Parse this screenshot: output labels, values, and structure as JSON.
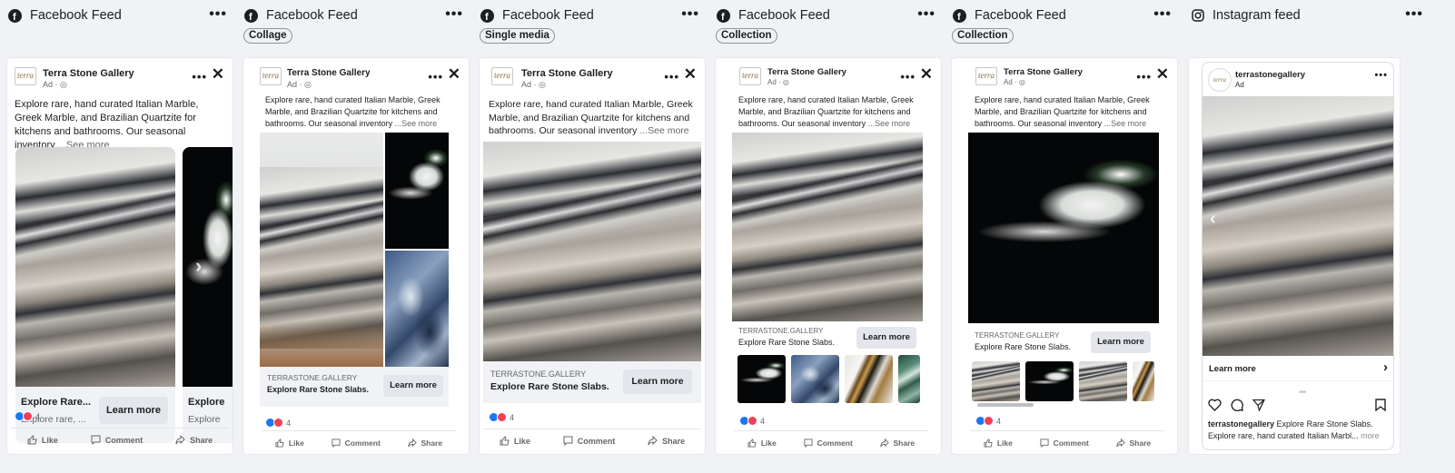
{
  "columns": [
    {
      "platform": "Facebook Feed",
      "format": "",
      "platform_icon": "facebook-icon"
    },
    {
      "platform": "Facebook Feed",
      "format": "Collage",
      "platform_icon": "facebook-icon"
    },
    {
      "platform": "Facebook Feed",
      "format": "Single media",
      "platform_icon": "facebook-icon"
    },
    {
      "platform": "Facebook Feed",
      "format": "Collection",
      "platform_icon": "facebook-icon"
    },
    {
      "platform": "Facebook Feed",
      "format": "Collection",
      "platform_icon": "facebook-icon"
    },
    {
      "platform": "Instagram feed",
      "format": "",
      "platform_icon": "instagram-icon"
    }
  ],
  "ad": {
    "brand": "Terra Stone Gallery",
    "ad_label": "Ad · ",
    "logo_text": "terra",
    "primary_text": "Explore rare, hand curated Italian Marble, Greek Marble, and Brazilian Quartzite for kitchens and bathrooms. Our seasonal inventory",
    "see_more": "...See more",
    "see_more_short": "...See more",
    "domain": "TERRASTONE.GALLERY",
    "headline": "Explore Rare Stone Slabs.",
    "carousel_headline": "Explore Rare...",
    "carousel_desc": "Explore rare, ...",
    "carousel_headline_2": "Explore",
    "carousel_desc_2": "Explore",
    "cta": "Learn more",
    "reaction_count": "4",
    "actions": {
      "like": "Like",
      "comment": "Comment",
      "share": "Share"
    }
  },
  "instagram": {
    "handle": "terrastonegallery",
    "ad_label": "Ad",
    "cta": "Learn more",
    "caption_handle": "terrastonegallery",
    "caption_text": " Explore Rare Stone Slabs.",
    "caption_line2": "Explore rare, hand curated Italian Marbl...",
    "more": "more"
  },
  "colors": {
    "background": "#f0f2f5",
    "card": "#ffffff",
    "cta_bg": "#e4e6eb",
    "like_blue": "#1877f2",
    "love_red": "#f33e58"
  }
}
